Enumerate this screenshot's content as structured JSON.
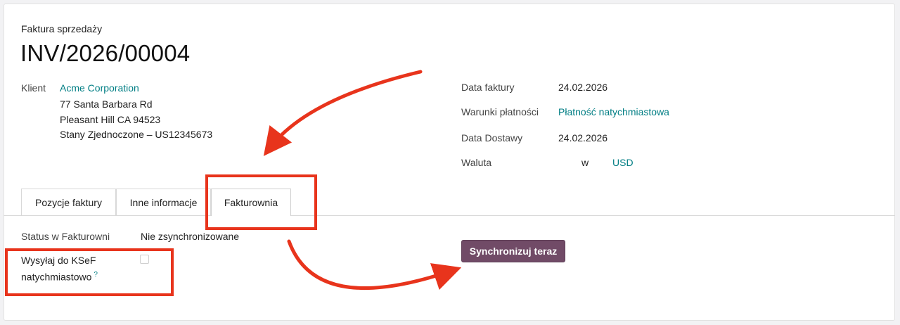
{
  "header": {
    "doc_type": "Faktura sprzedaży",
    "doc_number": "INV/2026/00004"
  },
  "customer": {
    "label": "Klient",
    "name": "Acme Corporation",
    "address": [
      "77 Santa Barbara Rd",
      "Pleasant Hill CA 94523",
      "Stany Zjednoczone – US12345673"
    ]
  },
  "details": {
    "invoice_date_label": "Data faktury",
    "invoice_date": "24.02.2026",
    "payment_terms_label": "Warunki płatności",
    "payment_terms": "Płatność natychmiastowa",
    "delivery_date_label": "Data Dostawy",
    "delivery_date": "24.02.2026",
    "currency_label": "Waluta",
    "currency_prefix": "w",
    "currency": "USD"
  },
  "tabs": [
    {
      "label": "Pozycje faktury",
      "active": false
    },
    {
      "label": "Inne informacje",
      "active": false
    },
    {
      "label": "Fakturownia",
      "active": true
    }
  ],
  "fakturownia": {
    "status_label": "Status w Fakturowni",
    "status_value": "Nie zsynchronizowane",
    "ksef_label_line1": "Wysyłaj do KSeF",
    "ksef_label_line2": "natychmiastowo",
    "help_marker": "?",
    "ksef_checked": false,
    "sync_button": "Synchronizuj teraz"
  },
  "annotations": {
    "highlight_color": "#e8341c"
  }
}
